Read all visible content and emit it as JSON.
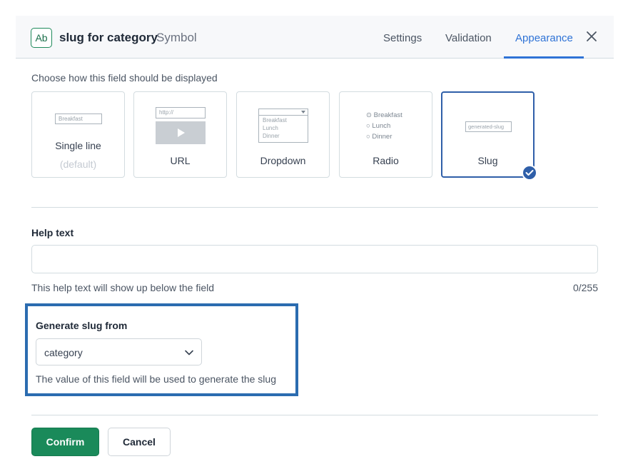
{
  "header": {
    "type_badge": "Ab",
    "field_name": "slug for category",
    "field_type": "Symbol",
    "tabs": [
      {
        "label": "Settings"
      },
      {
        "label": "Validation"
      },
      {
        "label": "Appearance"
      }
    ],
    "active_tab": "Appearance",
    "accent_color": "#2f73d6"
  },
  "appearance": {
    "instruction": "Choose how this field should be displayed",
    "selected": "Slug",
    "options": [
      {
        "label": "Single line",
        "sub": "(default)",
        "preview_placeholder": "Breakfast"
      },
      {
        "label": "URL",
        "preview_placeholder": "http://"
      },
      {
        "label": "Dropdown",
        "preview_items": [
          "Breakfast",
          "Lunch",
          "Dinner"
        ]
      },
      {
        "label": "Radio",
        "preview_items": [
          "Breakfast",
          "Lunch",
          "Dinner"
        ]
      },
      {
        "label": "Slug",
        "preview_placeholder": "generated-slug"
      }
    ]
  },
  "help_text": {
    "label": "Help text",
    "value": "",
    "hint": "This help text will show up below the field",
    "count": "0/255"
  },
  "slug_source": {
    "label": "Generate slug from",
    "selected": "category",
    "hint": "The value of this field will be used to generate the slug",
    "highlight_color": "#2b6cb0"
  },
  "actions": {
    "confirm_label": "Confirm",
    "cancel_label": "Cancel",
    "confirm_color": "#1a8a5a"
  }
}
